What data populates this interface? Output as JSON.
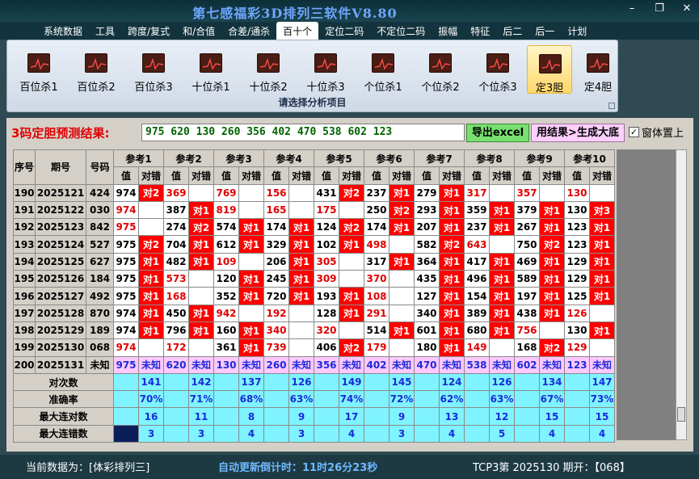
{
  "window": {
    "title": "第七感福彩3D排列三软件V8.80"
  },
  "menu": [
    "系统数据",
    "工具",
    "跨度/复式",
    "和/合值",
    "合差/通杀",
    "百十个",
    "定位二码",
    "不定位二码",
    "振幅",
    "特征",
    "后二",
    "后一",
    "计划"
  ],
  "menu_active": 5,
  "ribbon": {
    "buttons": [
      "百位杀1",
      "百位杀2",
      "百位杀3",
      "十位杀1",
      "十位杀2",
      "十位杀3",
      "个位杀1",
      "个位杀2",
      "个位杀3",
      "定3胆",
      "定4胆"
    ],
    "active": 9,
    "caption": "请选择分析项目"
  },
  "result": {
    "label": "3码定胆预测结果:",
    "value": "975 620 130 260 356 402 470 538 602 123",
    "export_button": "导出excel",
    "generate_button": "用结果>生成大底",
    "pin_label": "窗体置上",
    "pin_checked": true
  },
  "table": {
    "head": [
      "序号",
      "期号",
      "号码"
    ],
    "refs": [
      "参考1",
      "参考2",
      "参考3",
      "参考4",
      "参考5",
      "参考6",
      "参考7",
      "参考8",
      "参考9",
      "参考10"
    ],
    "sub": [
      "值",
      "对错"
    ],
    "rows": [
      {
        "seq": "190",
        "period": "2025121",
        "num": "424",
        "cells": [
          [
            "974",
            0,
            ""
          ],
          [
            "对2",
            1,
            ""
          ],
          [
            "369",
            0,
            "r"
          ],
          [
            "",
            0,
            ""
          ],
          [
            "769",
            0,
            "r"
          ],
          [
            "",
            0,
            ""
          ],
          [
            "156",
            0,
            "r"
          ],
          [
            "",
            0,
            ""
          ],
          [
            "431",
            0,
            ""
          ],
          [
            "对2",
            1,
            ""
          ],
          [
            "237",
            0,
            ""
          ],
          [
            "对1",
            1,
            ""
          ],
          [
            "279",
            0,
            ""
          ],
          [
            "对1",
            1,
            ""
          ],
          [
            "317",
            0,
            "r"
          ],
          [
            "",
            0,
            ""
          ],
          [
            "357",
            0,
            "r"
          ],
          [
            "",
            0,
            ""
          ],
          [
            "130",
            0,
            "r"
          ],
          [
            "",
            0,
            ""
          ]
        ]
      },
      {
        "seq": "191",
        "period": "2025122",
        "num": "030",
        "cells": [
          [
            "974",
            0,
            "r"
          ],
          [
            "",
            0,
            ""
          ],
          [
            "387",
            0,
            ""
          ],
          [
            "对1",
            1,
            ""
          ],
          [
            "819",
            0,
            "r"
          ],
          [
            "",
            0,
            ""
          ],
          [
            "165",
            0,
            "r"
          ],
          [
            "",
            0,
            ""
          ],
          [
            "175",
            0,
            "r"
          ],
          [
            "",
            0,
            ""
          ],
          [
            "250",
            0,
            ""
          ],
          [
            "对2",
            1,
            ""
          ],
          [
            "293",
            0,
            ""
          ],
          [
            "对1",
            1,
            ""
          ],
          [
            "359",
            0,
            ""
          ],
          [
            "对1",
            1,
            ""
          ],
          [
            "379",
            0,
            ""
          ],
          [
            "对1",
            1,
            ""
          ],
          [
            "130",
            0,
            ""
          ],
          [
            "对3",
            1,
            ""
          ]
        ]
      },
      {
        "seq": "192",
        "period": "2025123",
        "num": "842",
        "cells": [
          [
            "975",
            0,
            "r"
          ],
          [
            "",
            0,
            ""
          ],
          [
            "274",
            0,
            ""
          ],
          [
            "对2",
            1,
            ""
          ],
          [
            "574",
            0,
            ""
          ],
          [
            "对1",
            1,
            ""
          ],
          [
            "174",
            0,
            ""
          ],
          [
            "对1",
            1,
            ""
          ],
          [
            "124",
            0,
            ""
          ],
          [
            "对2",
            1,
            ""
          ],
          [
            "174",
            0,
            ""
          ],
          [
            "对1",
            1,
            ""
          ],
          [
            "207",
            0,
            ""
          ],
          [
            "对1",
            1,
            ""
          ],
          [
            "237",
            0,
            ""
          ],
          [
            "对1",
            1,
            ""
          ],
          [
            "267",
            0,
            ""
          ],
          [
            "对1",
            1,
            ""
          ],
          [
            "123",
            0,
            ""
          ],
          [
            "对1",
            1,
            ""
          ]
        ]
      },
      {
        "seq": "193",
        "period": "2025124",
        "num": "527",
        "cells": [
          [
            "975",
            0,
            ""
          ],
          [
            "对2",
            1,
            ""
          ],
          [
            "704",
            0,
            ""
          ],
          [
            "对1",
            1,
            ""
          ],
          [
            "612",
            0,
            ""
          ],
          [
            "对1",
            1,
            ""
          ],
          [
            "329",
            0,
            ""
          ],
          [
            "对1",
            1,
            ""
          ],
          [
            "102",
            0,
            ""
          ],
          [
            "对1",
            1,
            ""
          ],
          [
            "498",
            0,
            "r"
          ],
          [
            "",
            0,
            ""
          ],
          [
            "582",
            0,
            ""
          ],
          [
            "对2",
            1,
            ""
          ],
          [
            "643",
            0,
            "r"
          ],
          [
            "",
            0,
            ""
          ],
          [
            "750",
            0,
            ""
          ],
          [
            "对2",
            1,
            ""
          ],
          [
            "123",
            0,
            ""
          ],
          [
            "对1",
            1,
            ""
          ]
        ]
      },
      {
        "seq": "194",
        "period": "2025125",
        "num": "627",
        "cells": [
          [
            "975",
            0,
            ""
          ],
          [
            "对1",
            1,
            ""
          ],
          [
            "482",
            0,
            ""
          ],
          [
            "对1",
            1,
            ""
          ],
          [
            "109",
            0,
            "r"
          ],
          [
            "",
            0,
            ""
          ],
          [
            "206",
            0,
            ""
          ],
          [
            "对1",
            1,
            ""
          ],
          [
            "305",
            0,
            "r"
          ],
          [
            "",
            0,
            ""
          ],
          [
            "317",
            0,
            ""
          ],
          [
            "对1",
            1,
            ""
          ],
          [
            "364",
            0,
            ""
          ],
          [
            "对1",
            1,
            ""
          ],
          [
            "417",
            0,
            ""
          ],
          [
            "对1",
            1,
            ""
          ],
          [
            "469",
            0,
            ""
          ],
          [
            "对1",
            1,
            ""
          ],
          [
            "129",
            0,
            ""
          ],
          [
            "对1",
            1,
            ""
          ]
        ]
      },
      {
        "seq": "195",
        "period": "2025126",
        "num": "184",
        "cells": [
          [
            "975",
            0,
            ""
          ],
          [
            "对1",
            1,
            ""
          ],
          [
            "573",
            0,
            "r"
          ],
          [
            "",
            0,
            ""
          ],
          [
            "120",
            0,
            ""
          ],
          [
            "对1",
            1,
            ""
          ],
          [
            "245",
            0,
            ""
          ],
          [
            "对1",
            1,
            ""
          ],
          [
            "309",
            0,
            "r"
          ],
          [
            "",
            0,
            ""
          ],
          [
            "370",
            0,
            "r"
          ],
          [
            "",
            0,
            ""
          ],
          [
            "435",
            0,
            ""
          ],
          [
            "对1",
            1,
            ""
          ],
          [
            "496",
            0,
            ""
          ],
          [
            "对1",
            1,
            ""
          ],
          [
            "589",
            0,
            ""
          ],
          [
            "对1",
            1,
            ""
          ],
          [
            "129",
            0,
            ""
          ],
          [
            "对1",
            1,
            ""
          ]
        ]
      },
      {
        "seq": "196",
        "period": "2025127",
        "num": "492",
        "cells": [
          [
            "975",
            0,
            ""
          ],
          [
            "对1",
            1,
            ""
          ],
          [
            "168",
            0,
            "r"
          ],
          [
            "",
            0,
            ""
          ],
          [
            "352",
            0,
            ""
          ],
          [
            "对1",
            1,
            ""
          ],
          [
            "720",
            0,
            ""
          ],
          [
            "对1",
            1,
            ""
          ],
          [
            "193",
            0,
            ""
          ],
          [
            "对1",
            1,
            ""
          ],
          [
            "108",
            0,
            "r"
          ],
          [
            "",
            0,
            ""
          ],
          [
            "127",
            0,
            ""
          ],
          [
            "对1",
            1,
            ""
          ],
          [
            "154",
            0,
            ""
          ],
          [
            "对1",
            1,
            ""
          ],
          [
            "197",
            0,
            ""
          ],
          [
            "对1",
            1,
            ""
          ],
          [
            "125",
            0,
            ""
          ],
          [
            "对1",
            1,
            ""
          ]
        ]
      },
      {
        "seq": "197",
        "period": "2025128",
        "num": "870",
        "cells": [
          [
            "974",
            0,
            ""
          ],
          [
            "对1",
            1,
            ""
          ],
          [
            "450",
            0,
            ""
          ],
          [
            "对1",
            1,
            ""
          ],
          [
            "942",
            0,
            "r"
          ],
          [
            "",
            0,
            ""
          ],
          [
            "192",
            0,
            "r"
          ],
          [
            "",
            0,
            ""
          ],
          [
            "128",
            0,
            ""
          ],
          [
            "对1",
            1,
            ""
          ],
          [
            "291",
            0,
            "r"
          ],
          [
            "",
            0,
            ""
          ],
          [
            "340",
            0,
            ""
          ],
          [
            "对1",
            1,
            ""
          ],
          [
            "389",
            0,
            ""
          ],
          [
            "对1",
            1,
            ""
          ],
          [
            "438",
            0,
            ""
          ],
          [
            "对1",
            1,
            ""
          ],
          [
            "126",
            0,
            "r"
          ],
          [
            "",
            0,
            ""
          ]
        ]
      },
      {
        "seq": "198",
        "period": "2025129",
        "num": "189",
        "cells": [
          [
            "974",
            0,
            ""
          ],
          [
            "对1",
            1,
            ""
          ],
          [
            "796",
            0,
            ""
          ],
          [
            "对1",
            1,
            ""
          ],
          [
            "160",
            0,
            ""
          ],
          [
            "对1",
            1,
            ""
          ],
          [
            "340",
            0,
            "r"
          ],
          [
            "",
            0,
            ""
          ],
          [
            "320",
            0,
            "r"
          ],
          [
            "",
            0,
            ""
          ],
          [
            "514",
            0,
            ""
          ],
          [
            "对1",
            1,
            ""
          ],
          [
            "601",
            0,
            ""
          ],
          [
            "对1",
            1,
            ""
          ],
          [
            "680",
            0,
            ""
          ],
          [
            "对1",
            1,
            ""
          ],
          [
            "756",
            0,
            "r"
          ],
          [
            "",
            0,
            ""
          ],
          [
            "130",
            0,
            ""
          ],
          [
            "对1",
            1,
            ""
          ]
        ]
      },
      {
        "seq": "199",
        "period": "2025130",
        "num": "068",
        "cells": [
          [
            "974",
            0,
            "r"
          ],
          [
            "",
            0,
            ""
          ],
          [
            "172",
            0,
            "r"
          ],
          [
            "",
            0,
            ""
          ],
          [
            "361",
            0,
            ""
          ],
          [
            "对1",
            1,
            ""
          ],
          [
            "739",
            0,
            "r"
          ],
          [
            "",
            0,
            ""
          ],
          [
            "406",
            0,
            ""
          ],
          [
            "对2",
            1,
            ""
          ],
          [
            "179",
            0,
            "r"
          ],
          [
            "",
            0,
            ""
          ],
          [
            "180",
            0,
            ""
          ],
          [
            "对1",
            1,
            ""
          ],
          [
            "149",
            0,
            "r"
          ],
          [
            "",
            0,
            ""
          ],
          [
            "168",
            0,
            ""
          ],
          [
            "对2",
            1,
            ""
          ],
          [
            "129",
            0,
            "r"
          ],
          [
            "",
            0,
            ""
          ]
        ]
      }
    ],
    "predict_row": {
      "seq": "200",
      "period": "2025131",
      "num": "未知",
      "cells": [
        "975",
        "未知",
        "620",
        "未知",
        "130",
        "未知",
        "260",
        "未知",
        "356",
        "未知",
        "402",
        "未知",
        "470",
        "未知",
        "538",
        "未知",
        "602",
        "未知",
        "123",
        "未知"
      ]
    },
    "stats": [
      {
        "label": "对次数",
        "values": [
          "141",
          "142",
          "137",
          "126",
          "149",
          "145",
          "124",
          "126",
          "134",
          "147"
        ]
      },
      {
        "label": "准确率",
        "values": [
          "70%",
          "71%",
          "68%",
          "63%",
          "74%",
          "72%",
          "62%",
          "63%",
          "67%",
          "73%"
        ]
      },
      {
        "label": "最大连对数",
        "values": [
          "16",
          "11",
          "8",
          "9",
          "17",
          "9",
          "13",
          "12",
          "15",
          "15"
        ]
      },
      {
        "label": "最大连错数",
        "values": [
          "3",
          "3",
          "4",
          "3",
          "4",
          "3",
          "4",
          "5",
          "4",
          "4"
        ]
      }
    ]
  },
  "status": {
    "current": "当前数据为：[体彩排列三]",
    "countdown_label": "自动更新倒计时：",
    "countdown": "11时26分23秒",
    "draw": "TCP3第  2025130  期开：【068】"
  }
}
